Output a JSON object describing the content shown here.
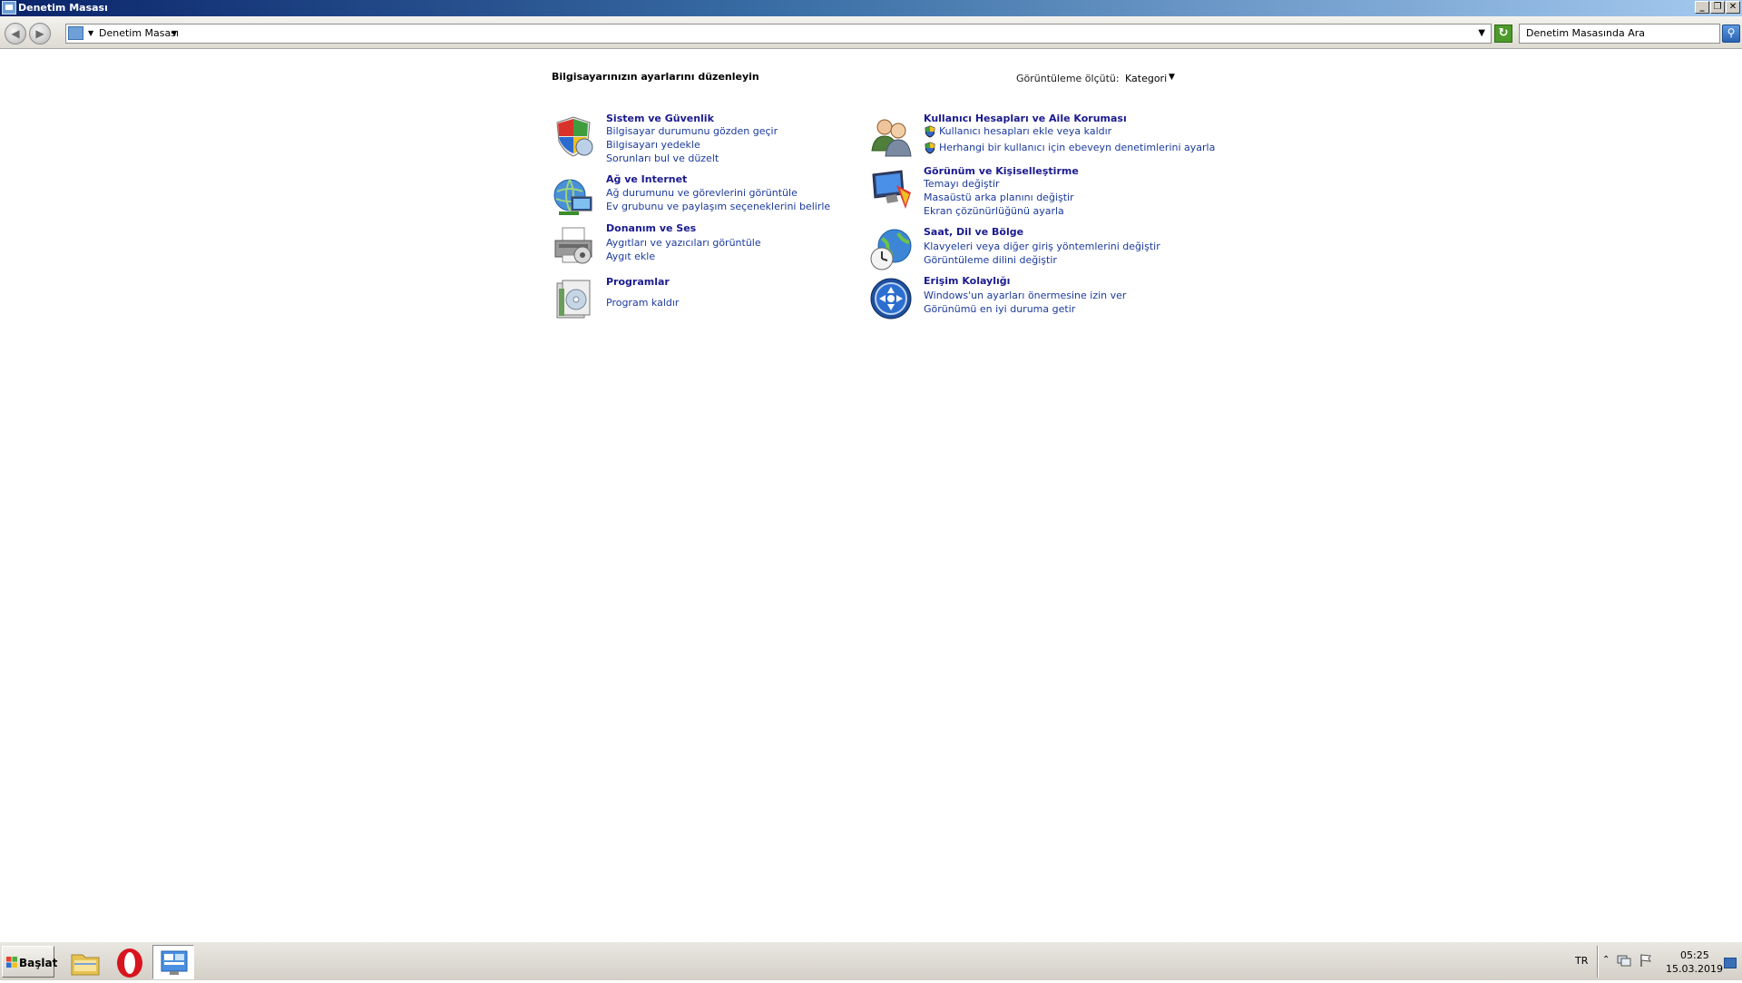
{
  "window": {
    "title": "Denetim Masası",
    "buttons": {
      "minimize": "_",
      "restore": "❐",
      "close": "✕"
    }
  },
  "address_bar": {
    "breadcrumb": "Denetim Masası",
    "search_placeholder": "Denetim Masasında Ara"
  },
  "main": {
    "title": "Bilgisayarınızın ayarlarını düzenleyin",
    "view_by_label": "Görüntüleme ölçütü:",
    "view_by_value": "Kategori",
    "categories": [
      {
        "name": "Sistem ve Güvenlik",
        "icon": "shield-icon",
        "links": [
          "Bilgisayar durumunu gözden geçir",
          "Bilgisayarı yedekle",
          "Sorunları bul ve düzelt"
        ]
      },
      {
        "name": "Ağ ve Internet",
        "icon": "network-globe-icon",
        "links": [
          "Ağ durumunu ve görevlerini görüntüle",
          "Ev grubunu ve paylaşım seçeneklerini belirle"
        ]
      },
      {
        "name": "Donanım ve Ses",
        "icon": "printer-icon",
        "links": [
          "Aygıtları ve yazıcıları görüntüle",
          "Aygıt ekle"
        ]
      },
      {
        "name": "Programlar",
        "icon": "programs-icon",
        "links": [
          "Program kaldır"
        ]
      },
      {
        "name": "Kullanıcı Hesapları ve Aile Koruması",
        "icon": "users-icon",
        "links": [
          "Kullanıcı hesapları ekle veya kaldır",
          "Herhangi bir kullanıcı için ebeveyn denetimlerini ayarla"
        ]
      },
      {
        "name": "Görünüm ve Kişiselleştirme",
        "icon": "display-icon",
        "links": [
          "Temayı değiştir",
          "Masaüstü arka planını değiştir",
          "Ekran çözünürlüğünü ayarla"
        ]
      },
      {
        "name": "Saat, Dil ve Bölge",
        "icon": "clock-globe-icon",
        "links": [
          "Klavyeleri veya diğer giriş yöntemlerini değiştir",
          "Görüntüleme dilini değiştir"
        ]
      },
      {
        "name": "Erişim Kolaylığı",
        "icon": "accessibility-icon",
        "links": [
          "Windows'un ayarları önermesine izin ver",
          "Görünümü en iyi duruma getir"
        ]
      }
    ]
  },
  "taskbar": {
    "start_label": "Başlat",
    "apps": [
      "file-explorer-icon",
      "opera-icon",
      "control-panel-icon"
    ],
    "language": "TR",
    "time": "05:25",
    "date": "15.03.2019"
  },
  "colors": {
    "link": "#1a3a9c",
    "heading": "#1a1a8f",
    "titlebar_start": "#0a246a",
    "titlebar_end": "#a6caf0"
  }
}
